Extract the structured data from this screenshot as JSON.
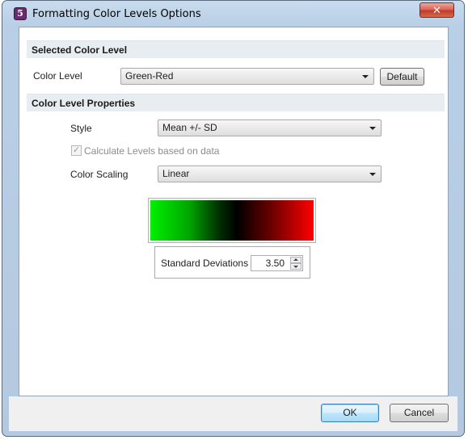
{
  "window": {
    "title": "Formatting Color Levels Options",
    "close_glyph": "✕",
    "icon": "app-logo-icon",
    "icon_glyph": "5"
  },
  "selected_color_level": {
    "header": "Selected Color Level",
    "color_level_label": "Color Level",
    "color_level_value": "Green-Red",
    "default_button": "Default"
  },
  "properties": {
    "header": "Color Level Properties",
    "style_label": "Style",
    "style_value": "Mean +/- SD",
    "calc_checkbox_label": "Calculate Levels based on data",
    "calc_checkbox_checked": true,
    "scaling_label": "Color Scaling",
    "scaling_value": "Linear"
  },
  "gradient": {
    "colors": [
      "#00f000",
      "#000000",
      "#ff0000"
    ]
  },
  "std_dev": {
    "label": "Standard Deviations",
    "value": "3.50"
  },
  "footer": {
    "ok": "OK",
    "cancel": "Cancel"
  }
}
